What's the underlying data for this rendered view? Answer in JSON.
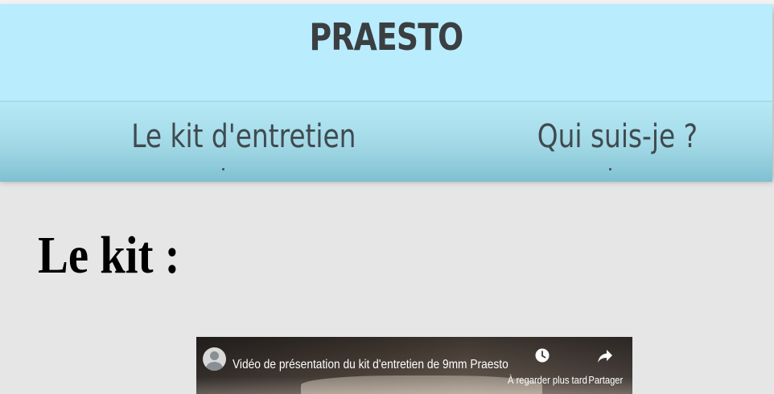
{
  "header": {
    "brand": "PRAESTO"
  },
  "nav": {
    "items": [
      {
        "label": "Le kit d'entretien"
      },
      {
        "label": "Qui suis-je ?"
      }
    ]
  },
  "main": {
    "section_title": "Le kit :"
  },
  "video": {
    "title": "Vidéo de présentation du kit d'entretien de 9mm Praesto",
    "watch_later_label": "À regarder plus tard",
    "share_label": "Partager",
    "icons": [
      "avatar-icon",
      "clock-icon",
      "share-icon"
    ]
  },
  "colors": {
    "header_bg": "#b9edfe",
    "nav_bg": "#a2d8e6",
    "page_bg": "#e6e6e6",
    "brand_text": "#3b3f42"
  }
}
